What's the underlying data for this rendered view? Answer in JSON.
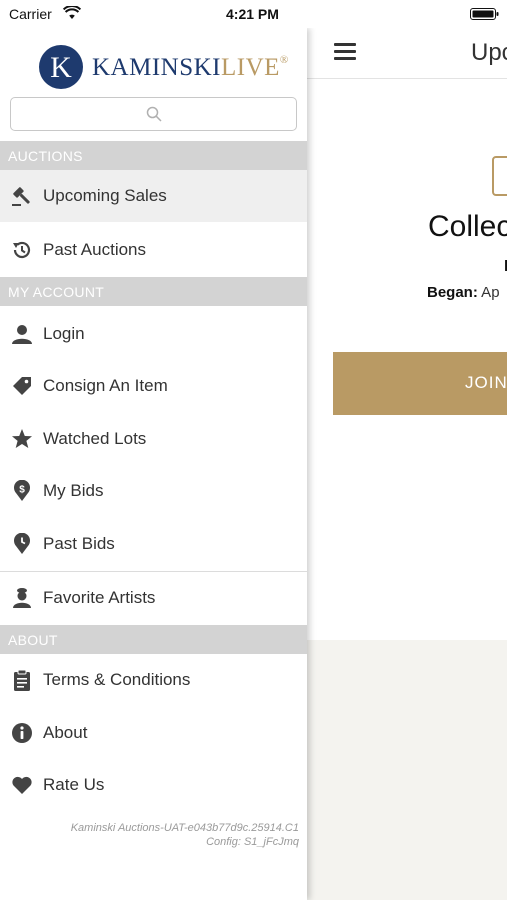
{
  "status_bar": {
    "carrier": "Carrier",
    "time": "4:21 PM"
  },
  "brand": {
    "name_part1": "KAMINSKI",
    "name_part2": "LIVE",
    "registered": "®",
    "logo_letter": "K",
    "colors": {
      "navy": "#1e3a6e",
      "gold": "#b99a64"
    }
  },
  "search": {
    "placeholder": "",
    "value": ""
  },
  "sections": {
    "auctions": "AUCTIONS",
    "my_account": "MY ACCOUNT",
    "about": "ABOUT"
  },
  "menu": {
    "upcoming_sales": {
      "label": "Upcoming Sales",
      "icon": "gavel-icon",
      "selected": true
    },
    "past_auctions": {
      "label": "Past Auctions",
      "icon": "history-icon"
    },
    "login": {
      "label": "Login",
      "icon": "user-icon"
    },
    "consign": {
      "label": "Consign An Item",
      "icon": "tag-icon"
    },
    "watched_lots": {
      "label": "Watched Lots",
      "icon": "star-icon"
    },
    "my_bids": {
      "label": "My Bids",
      "icon": "dollar-pin-icon"
    },
    "past_bids": {
      "label": "Past Bids",
      "icon": "clock-pin-icon"
    },
    "favorite_artists": {
      "label": "Favorite Artists",
      "icon": "artist-icon"
    },
    "terms": {
      "label": "Terms & Conditions",
      "icon": "clipboard-icon"
    },
    "about": {
      "label": "About",
      "icon": "info-icon"
    },
    "rate_us": {
      "label": "Rate Us",
      "icon": "heart-icon"
    }
  },
  "build_info": {
    "line1": "Kaminski Auctions-UAT-e043b77d9c.25914.C1",
    "line2": "Config: S1_jFcJmq"
  },
  "main": {
    "header_title": "Upc",
    "sale_title": "Collec",
    "sale_subtitle": "I",
    "began_label": "Began:",
    "began_value": " Ap",
    "join_button": "JOIN"
  }
}
